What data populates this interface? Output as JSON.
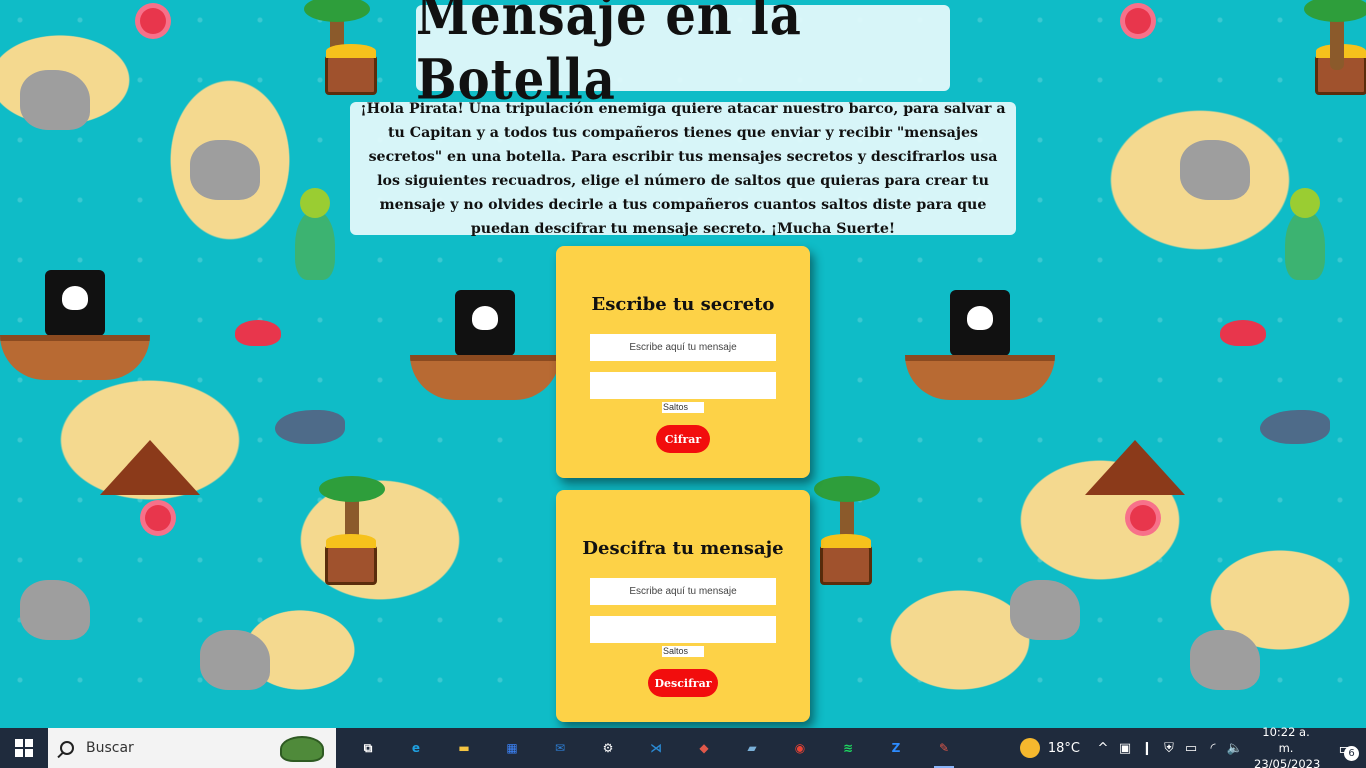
{
  "header": {
    "title": "Mensaje en la Botella",
    "intro": "¡Hola Pirata! Una tripulación enemiga quiere atacar nuestro barco, para salvar a tu Capitan y a todos tus compañeros tienes que enviar y recibir \"mensajes secretos\" en una botella. Para escribir tus mensajes secretos y descifrarlos usa los siguientes recuadros, elige el número de saltos que quieras para crear tu mensaje y no olvides decirle a tus compañeros cuantos saltos diste para que puedan descifrar tu mensaje secreto. ¡Mucha Suerte!"
  },
  "cipher_card": {
    "title": "Escribe tu secreto",
    "message_placeholder": "Escribe aquí tu mensaje",
    "message_value": "",
    "output_value": "",
    "steps_placeholder": "Saltos",
    "button_label": "Cifrar"
  },
  "decipher_card": {
    "title": "Descifra tu mensaje",
    "message_placeholder": "Escribe aquí tu mensaje",
    "message_value": "",
    "output_value": "",
    "steps_placeholder": "Saltos",
    "button_label": "Descifrar"
  },
  "taskbar": {
    "search_placeholder": "Buscar",
    "apps": [
      {
        "name": "task-view",
        "icon": "task-view-icon",
        "glyph": "⧉",
        "color": "#ffffff"
      },
      {
        "name": "edge",
        "icon": "edge-icon",
        "glyph": "e",
        "color": "#1fa0e0"
      },
      {
        "name": "file-explorer",
        "icon": "folder-icon",
        "glyph": "▬",
        "color": "#f5c542"
      },
      {
        "name": "store",
        "icon": "store-icon",
        "glyph": "▦",
        "color": "#3b82f6"
      },
      {
        "name": "mail",
        "icon": "mail-icon",
        "glyph": "✉",
        "color": "#2d7dd2"
      },
      {
        "name": "settings",
        "icon": "gear-icon",
        "glyph": "⚙",
        "color": "#ffffff"
      },
      {
        "name": "vscode",
        "icon": "vscode-icon",
        "glyph": "⋊",
        "color": "#2a8ad4"
      },
      {
        "name": "git",
        "icon": "git-icon",
        "glyph": "◆",
        "color": "#e0584a"
      },
      {
        "name": "notes",
        "icon": "notes-icon",
        "glyph": "▰",
        "color": "#7ab0d8"
      },
      {
        "name": "chrome",
        "icon": "chrome-icon",
        "glyph": "◉",
        "color": "#e84335"
      },
      {
        "name": "spotify",
        "icon": "spotify-icon",
        "glyph": "≋",
        "color": "#1ed760"
      },
      {
        "name": "zoom",
        "icon": "zoom-icon",
        "glyph": "Z",
        "color": "#2d8cff"
      },
      {
        "name": "paint",
        "icon": "paint-icon",
        "glyph": "✎",
        "color": "#e0584a"
      }
    ],
    "weather": {
      "temperature": "18°C",
      "icon": "weather-sun-icon"
    },
    "tray_icons": [
      {
        "name": "chevron-up-icon",
        "glyph": "^"
      },
      {
        "name": "camera-icon",
        "glyph": "▣"
      },
      {
        "name": "microphone-icon",
        "glyph": "❙"
      },
      {
        "name": "shield-icon",
        "glyph": "⛨"
      },
      {
        "name": "battery-icon",
        "glyph": "▭"
      },
      {
        "name": "wifi-icon",
        "glyph": "◜"
      },
      {
        "name": "volume-icon",
        "glyph": "🔈"
      }
    ],
    "clock": {
      "time": "10:22 a. m.",
      "date": "23/05/2023"
    },
    "notifications": {
      "count": "6"
    }
  }
}
